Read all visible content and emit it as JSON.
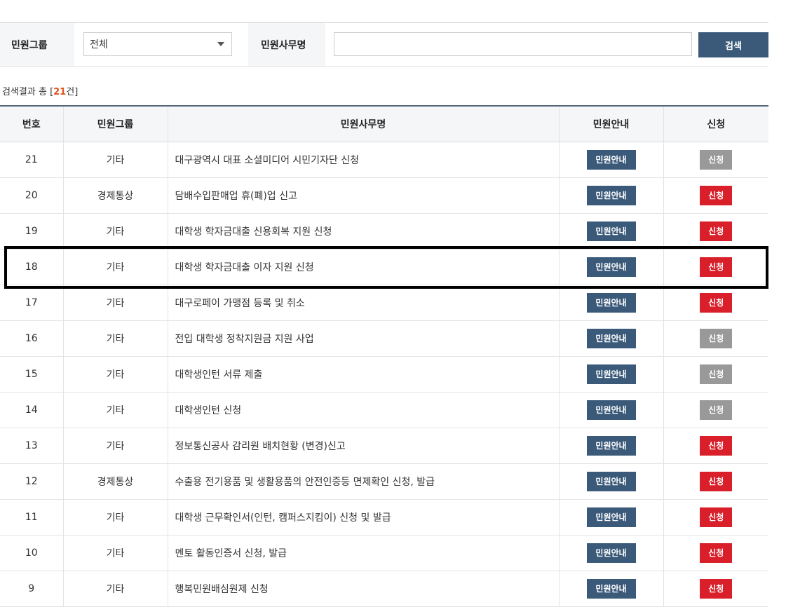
{
  "search": {
    "group_label": "민원그룹",
    "group_selected": "전체",
    "name_label": "민원사무명",
    "name_value": "",
    "button_label": "검색"
  },
  "result": {
    "prefix": "검색결과 총 [",
    "count": "21",
    "suffix": "건]"
  },
  "table": {
    "headers": {
      "no": "번호",
      "group": "민원그룹",
      "name": "민원사무명",
      "guide": "민원안내",
      "apply": "신청"
    },
    "rows": [
      {
        "no": "21",
        "group": "기타",
        "name": "대구광역시 대표 소셜미디어 시민기자단 신청",
        "guide": "민원안내",
        "apply": "신청",
        "apply_active": false
      },
      {
        "no": "20",
        "group": "경제통상",
        "name": "담배수입판매업 휴(폐)업 신고",
        "guide": "민원안내",
        "apply": "신청",
        "apply_active": true
      },
      {
        "no": "19",
        "group": "기타",
        "name": "대학생 학자금대출 신용회복 지원 신청",
        "guide": "민원안내",
        "apply": "신청",
        "apply_active": true
      },
      {
        "no": "18",
        "group": "기타",
        "name": "대학생 학자금대출 이자 지원 신청",
        "guide": "민원안내",
        "apply": "신청",
        "apply_active": true
      },
      {
        "no": "17",
        "group": "기타",
        "name": "대구로페이 가맹점 등록 및 취소",
        "guide": "민원안내",
        "apply": "신청",
        "apply_active": true
      },
      {
        "no": "16",
        "group": "기타",
        "name": "전입 대학생 정착지원금 지원 사업",
        "guide": "민원안내",
        "apply": "신청",
        "apply_active": false
      },
      {
        "no": "15",
        "group": "기타",
        "name": "대학생인턴 서류 제출",
        "guide": "민원안내",
        "apply": "신청",
        "apply_active": false
      },
      {
        "no": "14",
        "group": "기타",
        "name": "대학생인턴 신청",
        "guide": "민원안내",
        "apply": "신청",
        "apply_active": false
      },
      {
        "no": "13",
        "group": "기타",
        "name": "정보통신공사 감리원 배치현황 (변경)신고",
        "guide": "민원안내",
        "apply": "신청",
        "apply_active": true
      },
      {
        "no": "12",
        "group": "경제통상",
        "name": "수출용 전기용품 및 생활용품의 안전인증등 면제확인 신청, 발급",
        "guide": "민원안내",
        "apply": "신청",
        "apply_active": true
      },
      {
        "no": "11",
        "group": "기타",
        "name": "대학생 근무확인서(인턴, 캠퍼스지킴이) 신청 및 발급",
        "guide": "민원안내",
        "apply": "신청",
        "apply_active": true
      },
      {
        "no": "10",
        "group": "기타",
        "name": "멘토 활동인증서 신청, 발급",
        "guide": "민원안내",
        "apply": "신청",
        "apply_active": true
      },
      {
        "no": "9",
        "group": "기타",
        "name": "행복민원배심원제 신청",
        "guide": "민원안내",
        "apply": "신청",
        "apply_active": true
      }
    ]
  },
  "colors": {
    "primary": "#3b5a7a",
    "apply_active": "#d9202a",
    "apply_inactive": "#999999",
    "count_highlight": "#e2531e"
  }
}
